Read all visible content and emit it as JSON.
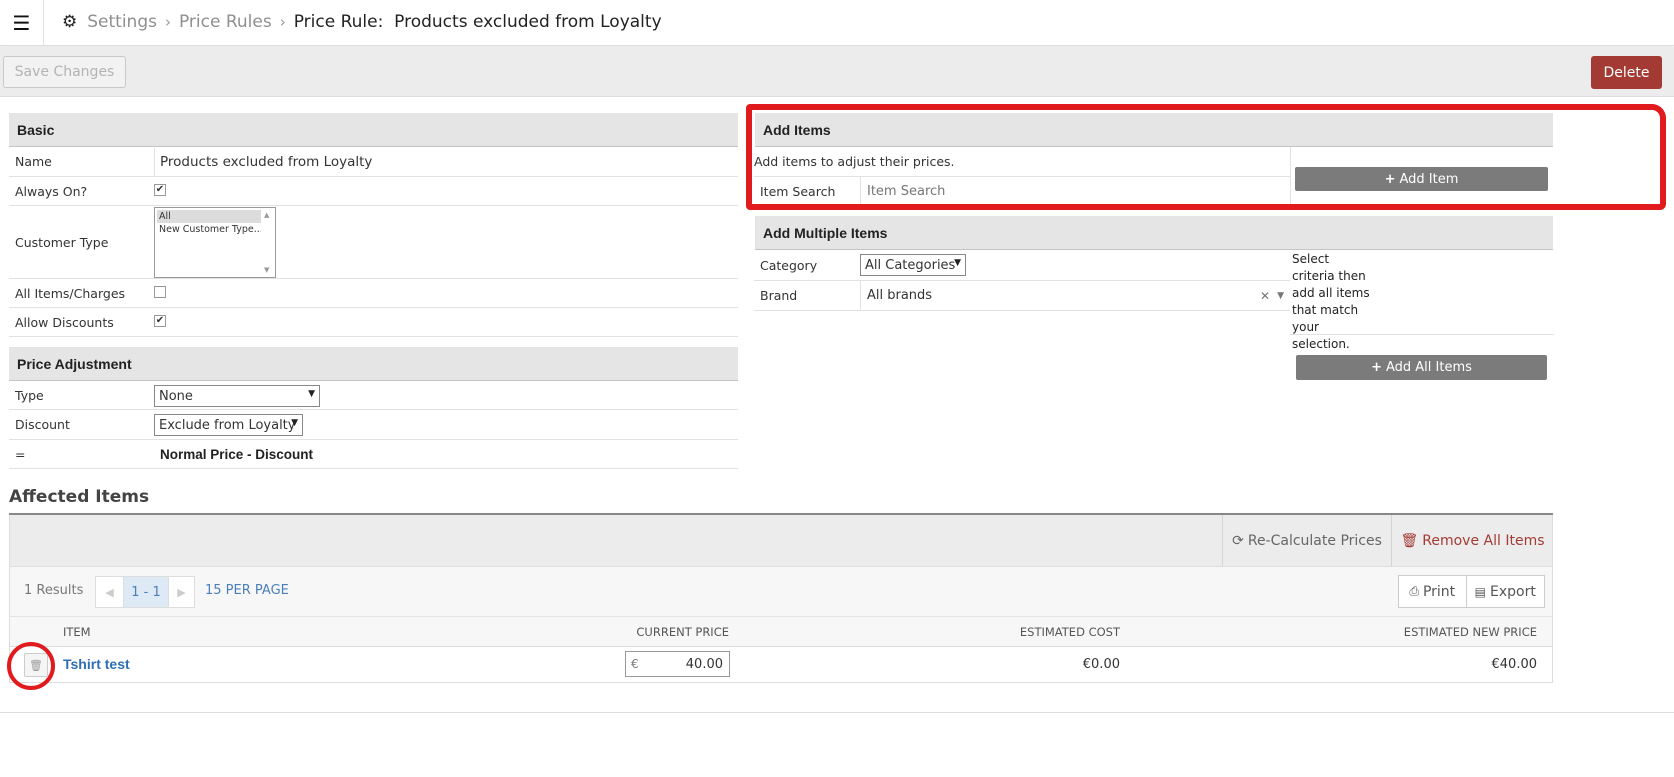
{
  "header": {
    "menu_icon": "hamburger-icon",
    "settings_icon": "gear-icon",
    "breadcrumb": [
      "Settings",
      "Price Rules"
    ],
    "current": "Price Rule:  Products excluded from Loyalty"
  },
  "toolbar": {
    "save_label": "Save Changes",
    "delete_label": "Delete"
  },
  "basic": {
    "title": "Basic",
    "name_label": "Name",
    "name_value": "Products excluded from Loyalty",
    "always_on_label": "Always On?",
    "customer_type_label": "Customer Type",
    "customer_type_options": [
      "All",
      "New Customer Type..."
    ],
    "all_items_label": "All Items/Charges",
    "allow_discounts_label": "Allow Discounts"
  },
  "price_adjustment": {
    "title": "Price Adjustment",
    "type_label": "Type",
    "type_value": "None",
    "discount_label": "Discount",
    "discount_value": "Exclude from Loyalty",
    "eq_label": "=",
    "eq_value": "Normal Price - Discount"
  },
  "add_items": {
    "title": "Add Items",
    "hint": "Add items to adjust their prices.",
    "search_label": "Item Search",
    "search_placeholder": "Item Search",
    "add_button": "Add Item"
  },
  "add_multiple": {
    "title": "Add Multiple Items",
    "category_label": "Category",
    "category_value": "All Categories",
    "brand_label": "Brand",
    "brand_value": "All brands",
    "note": "Select criteria then add all items that match your selection.",
    "add_all_button": "Add All Items"
  },
  "affected": {
    "title": "Affected Items",
    "recalc_label": "Re-Calculate Prices",
    "remove_all_label": "Remove All Items",
    "results": "1 Results",
    "page_range": "1 - 1",
    "per_page": "15 PER PAGE",
    "print_label": "Print",
    "export_label": "Export",
    "columns": [
      "ITEM",
      "CURRENT PRICE",
      "ESTIMATED COST",
      "ESTIMATED NEW PRICE"
    ],
    "rows": [
      {
        "item": "Tshirt test",
        "currency": "€",
        "current_price": "40.00",
        "estimated_cost": "€0.00",
        "estimated_new_price": "€40.00"
      }
    ]
  },
  "colors": {
    "annotation": "#e11a1e",
    "delete": "#a33a34",
    "link": "#2e6fb4",
    "gray_button": "#7b7b7b"
  }
}
